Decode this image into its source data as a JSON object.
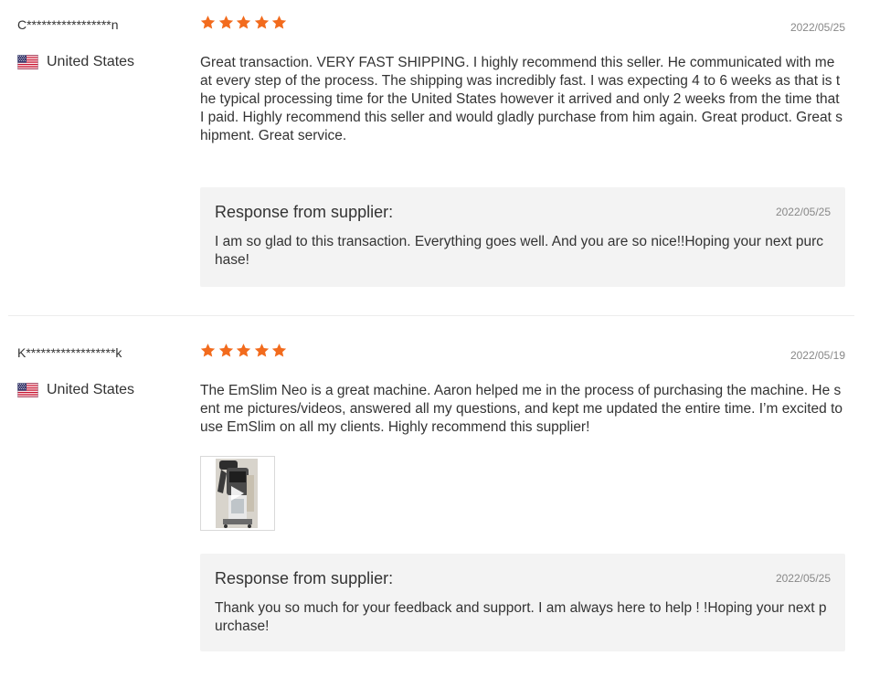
{
  "reviews": [
    {
      "reviewer": "C*****************n",
      "country": "United States",
      "rating": 5,
      "date": "2022/05/25",
      "text": "Great transaction. VERY FAST SHIPPING. I highly recommend this seller. He communicated with me at every step of the process. The shipping was incredibly fast. I was expecting 4 to 6 weeks as that is the typical processing time for the United States however it arrived and only 2 weeks from the time that I paid. Highly recommend this seller and would gladly purchase from him again. Great product. Great shipment. Great service.",
      "response": {
        "title": "Response from supplier:",
        "date": "2022/05/25",
        "text": "I am so glad to this transaction. Everything goes well. And you are so nice!!Hoping your next purchase!"
      }
    },
    {
      "reviewer": "K******************k",
      "country": "United States",
      "rating": 5,
      "date": "2022/05/19",
      "text": "The EmSlim Neo is a great machine. Aaron helped me in the process of purchasing the machine. He sent me pictures/videos, answered all my questions, and kept me updated the entire time. I’m excited to use EmSlim on all my clients. Highly recommend this supplier!",
      "media": "video-thumbnail",
      "response": {
        "title": "Response from supplier:",
        "date": "2022/05/25",
        "text": "Thank you so much for your feedback and support. I am always here to help ! !Hoping your next purchase!"
      }
    }
  ],
  "colors": {
    "star": "#f26b1d",
    "response_bg": "#f3f3f3",
    "date": "#888888"
  },
  "icons": {
    "star": "star-icon",
    "flag": "us-flag-icon",
    "play": "play-icon"
  }
}
